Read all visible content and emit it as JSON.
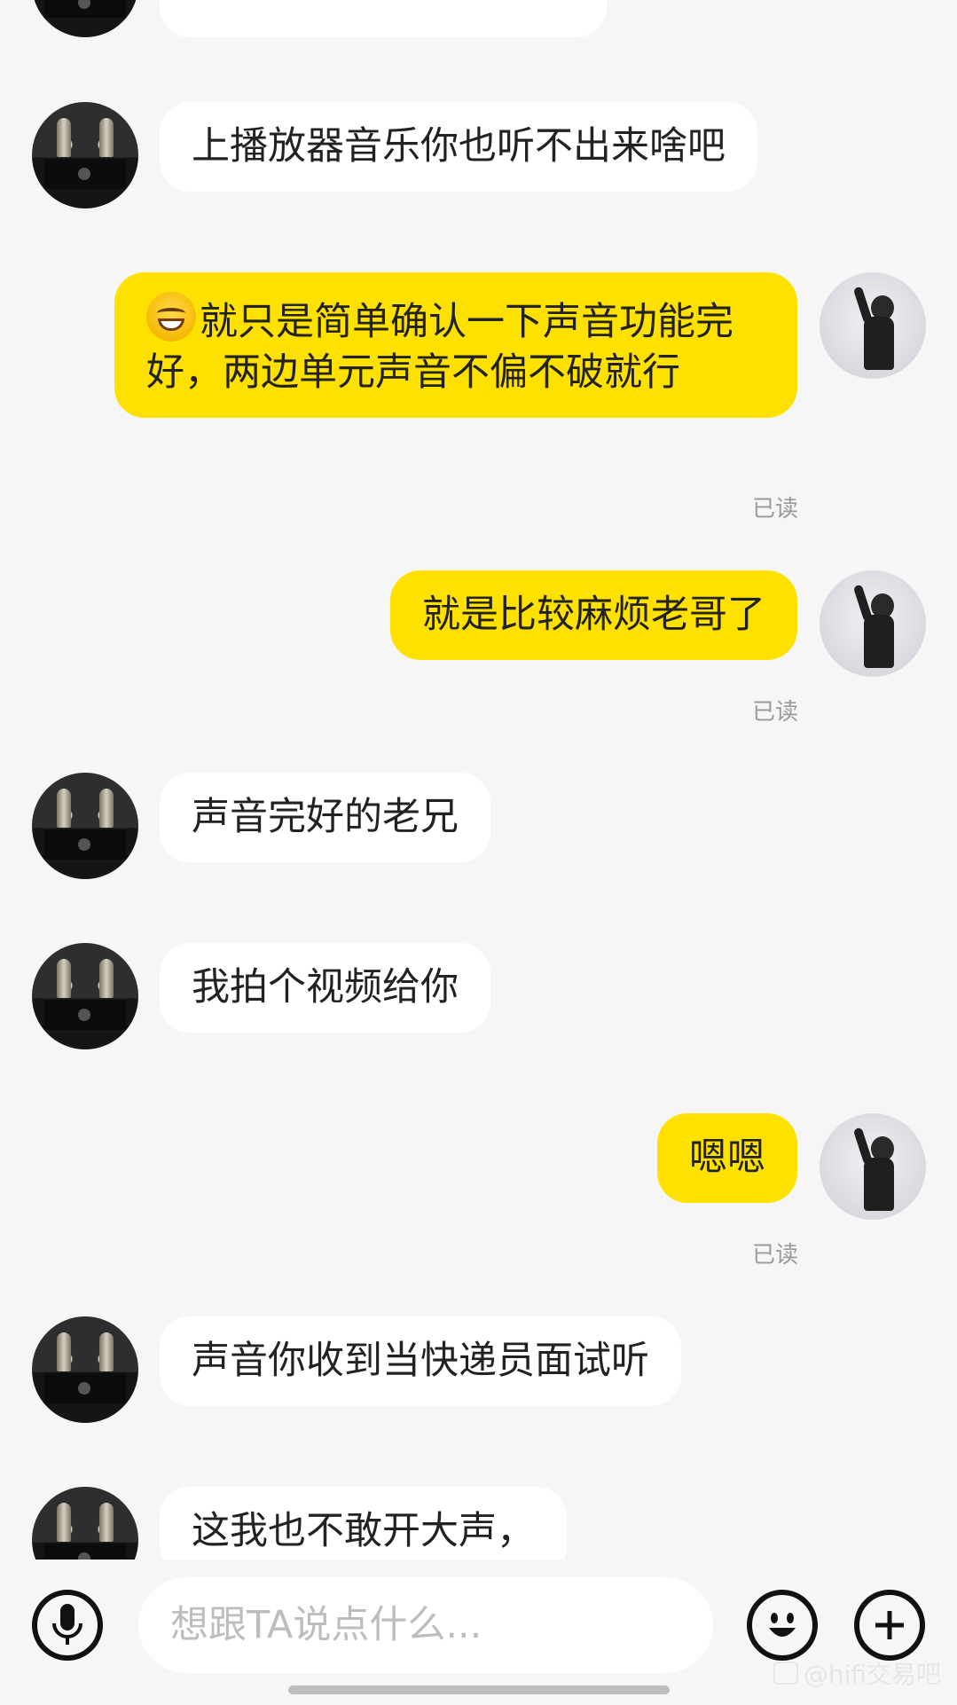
{
  "messages": {
    "m1": {
      "text": "上播放器音乐你也听不出来啥吧"
    },
    "m2": {
      "text": "就只是简单确认一下声音功能完好，两边单元声音不偏不破就行",
      "emoji": "grinning-face-icon",
      "read": "已读"
    },
    "m3": {
      "text": "就是比较麻烦老哥了",
      "read": "已读"
    },
    "m4": {
      "text": "声音完好的老兄"
    },
    "m5": {
      "text": "我拍个视频给你"
    },
    "m6": {
      "text": "嗯嗯",
      "read": "已读"
    },
    "m7": {
      "text": "声音你收到当快递员面试听"
    },
    "m8": {
      "text": "这我也不敢开大声，"
    }
  },
  "input": {
    "placeholder": "想跟TA说点什么..."
  },
  "toolbar": {
    "voice_icon": "microphone-icon",
    "emoji_icon": "smile-icon",
    "more_icon": "plus-icon"
  },
  "watermark": {
    "text": "@hifi交易吧"
  },
  "colors": {
    "background": "#f6f6f6",
    "sent_bubble": "#ffe100",
    "received_bubble": "#ffffff",
    "read_text": "#9a9a9a"
  }
}
